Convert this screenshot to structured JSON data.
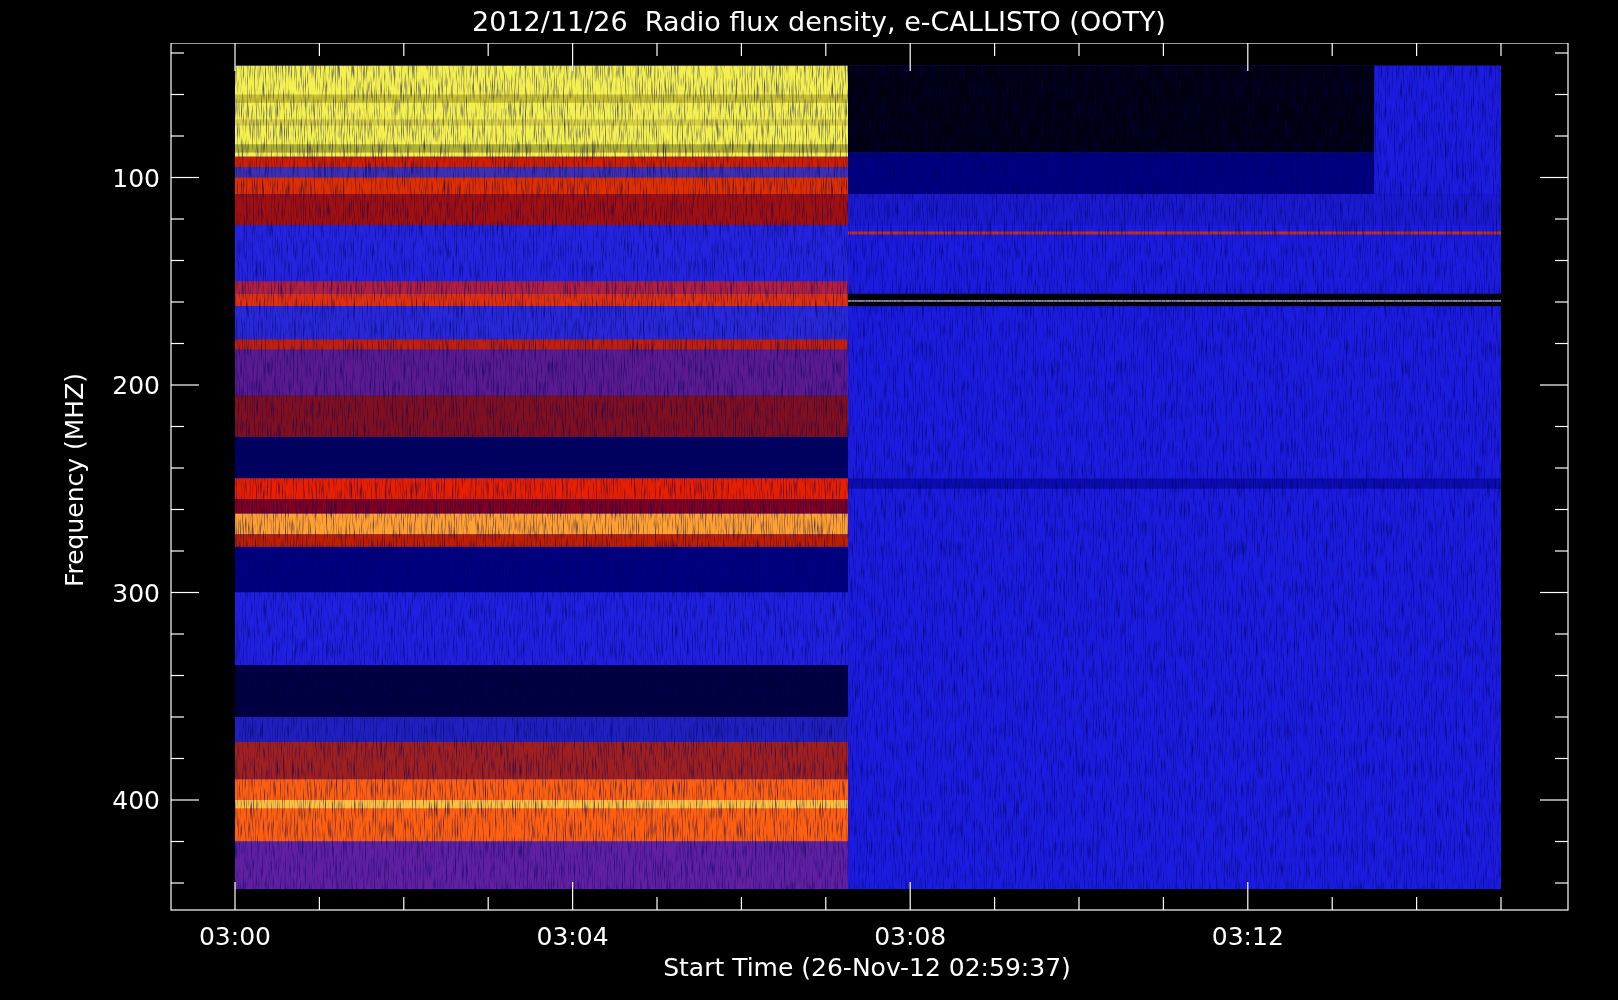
{
  "title": "2012/11/26  Radio flux density, e-CALLISTO (OOTY)",
  "chart": {
    "ylabel": "Frequency (MHZ)",
    "xlabel": "Start Time (26-Nov-12 02:59:37)",
    "yticks": [
      "100",
      "200",
      "300",
      "400"
    ],
    "xticks": [
      "03:00",
      "03:04",
      "03:08",
      "03:12"
    ]
  }
}
